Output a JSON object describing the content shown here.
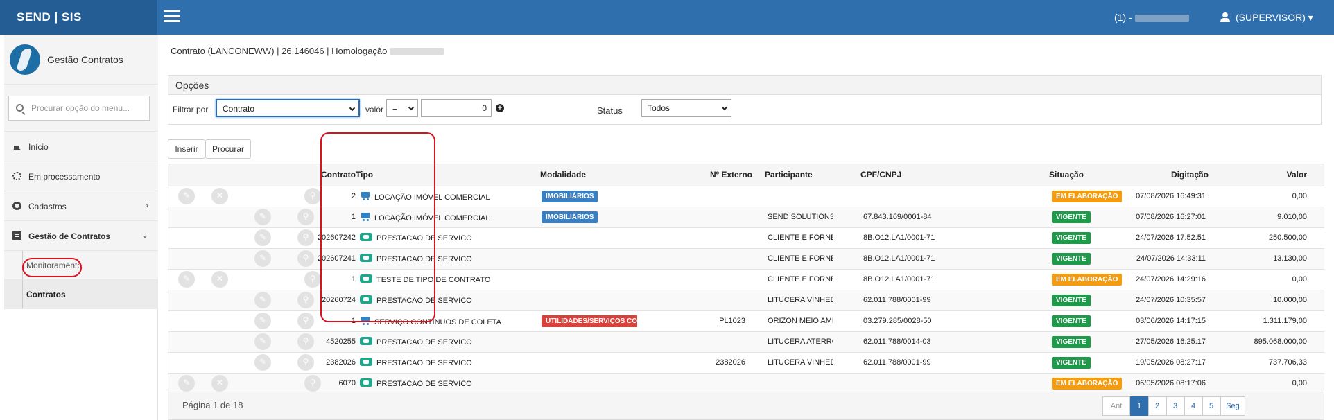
{
  "app": {
    "brand": "SEND | SIS",
    "counter": "(1) -",
    "user": "(SUPERVISOR)"
  },
  "sidebar": {
    "module_title": "Gestão Contratos",
    "search_placeholder": "Procurar opção do menu...",
    "items": [
      {
        "label": "Início",
        "icon": "home-icon"
      },
      {
        "label": "Em processamento",
        "icon": "spinner-icon"
      },
      {
        "label": "Cadastros",
        "icon": "gears-icon"
      },
      {
        "label": "Gestão de Contratos",
        "icon": "document-icon"
      }
    ],
    "sub_items": [
      {
        "label": "Monitoramento"
      },
      {
        "label": "Contratos"
      }
    ]
  },
  "main": {
    "breadcrumb": "Contrato (LANCONEWW) | 26.146046 | Homologação",
    "options": {
      "title": "Opções",
      "filter_label": "Filtrar por",
      "filter_value": "Contrato",
      "valor_label": "valor",
      "operator": "=",
      "value": "0",
      "status_label": "Status",
      "status_value": "Todos"
    },
    "buttons": {
      "insert": "Inserir",
      "search": "Procurar"
    },
    "table": {
      "headers": {
        "contrato": "Contrato",
        "tipo": "Tipo",
        "modalidade": "Modalidade",
        "externo": "Nº Externo",
        "participante": "Participante",
        "cnpj": "CPF/CNPJ",
        "situacao": "Situação",
        "digitacao": "Digitação",
        "valor": "Valor"
      },
      "rows": [
        {
          "contrato": "2",
          "tipo": "LOCAÇÃO IMÓVEL COMERCIAL",
          "modalidade": "IMOBILIÁRIOS",
          "externo": "",
          "participante": "",
          "cnpj": "",
          "situacao": "EM ELABORAÇÃO",
          "digitacao": "07/08/2026 16:49:31",
          "valor": "0,00"
        },
        {
          "contrato": "1",
          "tipo": "LOCAÇÃO IMÓVEL COMERCIAL",
          "modalidade": "IMOBILIÁRIOS",
          "externo": "",
          "participante": "SEND SOLUTIONS",
          "cnpj": "67.843.169/0001-84",
          "situacao": "VIGENTE",
          "digitacao": "07/08/2026 16:27:01",
          "valor": "9.010,00"
        },
        {
          "contrato": "202607242",
          "tipo": "PRESTACAO DE SERVICO",
          "modalidade": "",
          "externo": "",
          "participante": "CLIENTE E FORNECEDOR CNPJ ALFANUMERICO",
          "cnpj": "8B.O12.LA1/0001-71",
          "situacao": "VIGENTE",
          "digitacao": "24/07/2026 17:52:51",
          "valor": "250.500,00"
        },
        {
          "contrato": "202607241",
          "tipo": "PRESTACAO DE SERVICO",
          "modalidade": "",
          "externo": "",
          "participante": "CLIENTE E FORNECEDOR CNPJ ALFANUMERICO",
          "cnpj": "8B.O12.LA1/0001-71",
          "situacao": "VIGENTE",
          "digitacao": "24/07/2026 14:33:11",
          "valor": "13.130,00"
        },
        {
          "contrato": "1",
          "tipo": "TESTE DE TIPO DE CONTRATO",
          "modalidade": "",
          "externo": "",
          "participante": "CLIENTE E FORNECEDOR CNPJ ALFANUMERICO",
          "cnpj": "8B.O12.LA1/0001-71",
          "situacao": "EM ELABORAÇÃO",
          "digitacao": "24/07/2026 14:29:16",
          "valor": "0,00"
        },
        {
          "contrato": "20260724",
          "tipo": "PRESTACAO DE SERVICO",
          "modalidade": "",
          "externo": "",
          "participante": "LITUCERA VINHEDO",
          "cnpj": "62.011.788/0001-99",
          "situacao": "VIGENTE",
          "digitacao": "24/07/2026 10:35:57",
          "valor": "10.000,00"
        },
        {
          "contrato": "1",
          "tipo": "SERVIÇO CONTÍNUOS DE COLETA",
          "modalidade": "UTILIDADES/SERVIÇOS CONTÍNUOS",
          "externo": "PL1023",
          "participante": "ORIZON MEIO AMBIENTE S.A.",
          "cnpj": "03.279.285/0028-50",
          "situacao": "VIGENTE",
          "digitacao": "03/06/2026 14:17:15",
          "valor": "1.311.179,00"
        },
        {
          "contrato": "4520255",
          "tipo": "PRESTACAO DE SERVICO",
          "modalidade": "",
          "externo": "",
          "participante": "LITUCERA ATERRO",
          "cnpj": "62.011.788/0014-03",
          "situacao": "VIGENTE",
          "digitacao": "27/05/2026 16:25:17",
          "valor": "895.068.000,00"
        },
        {
          "contrato": "2382026",
          "tipo": "PRESTACAO DE SERVICO",
          "modalidade": "",
          "externo": "2382026",
          "participante": "LITUCERA VINHEDO",
          "cnpj": "62.011.788/0001-99",
          "situacao": "VIGENTE",
          "digitacao": "19/05/2026 08:27:17",
          "valor": "737.706,33"
        },
        {
          "contrato": "6070",
          "tipo": "PRESTACAO DE SERVICO",
          "modalidade": "",
          "externo": "",
          "participante": "",
          "cnpj": "",
          "situacao": "EM ELABORAÇÃO",
          "digitacao": "06/05/2026 08:17:06",
          "valor": "0,00"
        }
      ]
    },
    "pagination": {
      "info": "Página 1 de 18",
      "prev": "Ant",
      "pages": [
        "1",
        "2",
        "3",
        "4",
        "5"
      ],
      "next": "Seg"
    }
  },
  "colors": {
    "topbar": "#2f6fad",
    "vigente": "#1e9a4a",
    "em_elaboracao": "#f39c12",
    "modalidade_blue": "#3a7fc1",
    "modalidade_red": "#d9413a",
    "annotation": "#d9121f"
  }
}
